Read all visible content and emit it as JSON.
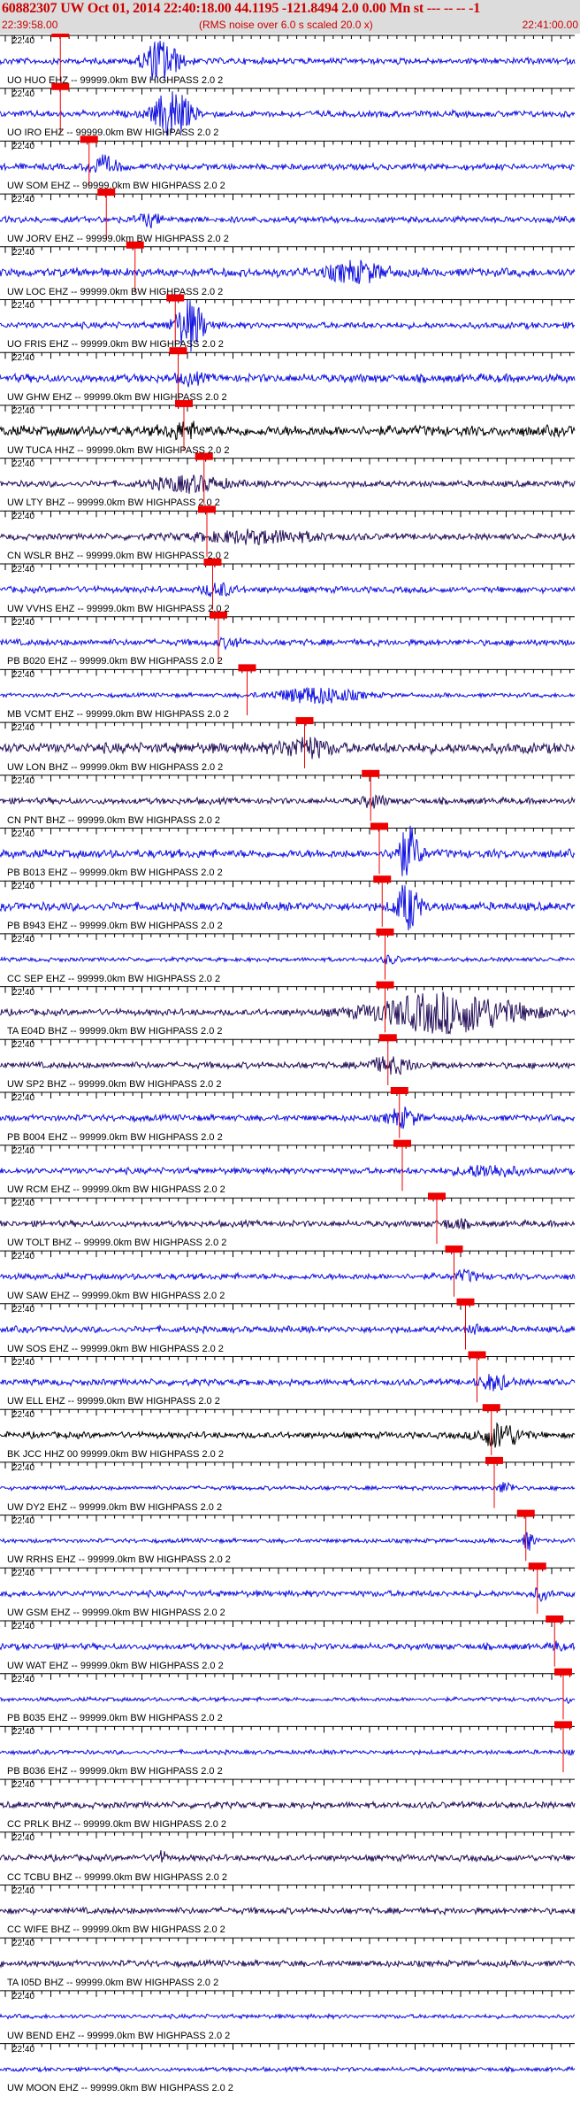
{
  "header": {
    "title": "60882307 UW Oct 01, 2014 22:40:18.00   44.1195 -121.8494  2.0 0.00 Mn st --- -- --  -1",
    "start_time": "22:39:58.00",
    "rms_note": "(RMS noise over 6.0 s scaled 20.0 x)",
    "end_time": "22:41:00.00"
  },
  "colors": {
    "header_text": "#cc0000",
    "header_bg": "#dcdcdc",
    "trace_blue": "#1010e0",
    "trace_dark": "#26105a",
    "trace_black": "#000000",
    "pick_box": "#ee0000",
    "grid": "#000000"
  },
  "time_tick_label": "22:40",
  "stations": [
    {
      "label": "UO HUO EHZ -- 99999.0km BW  HIGHPASS  2.0  2",
      "color": "blue",
      "amp": 3,
      "pick": 0.105,
      "burst": [
        0.28,
        0.06,
        24
      ]
    },
    {
      "label": "UO IRO EHZ -- 99999.0km BW  HIGHPASS  2.0  2",
      "color": "blue",
      "amp": 3,
      "pick": 0.105,
      "burst": [
        0.3,
        0.06,
        28
      ]
    },
    {
      "label": "UW SOM EHZ -- 99999.0km BW  HIGHPASS  2.0  2",
      "color": "blue",
      "amp": 3,
      "pick": 0.155,
      "burst": [
        0.18,
        0.05,
        10
      ]
    },
    {
      "label": "UW JORV EHZ -- 99999.0km BW  HIGHPASS  2.0  2",
      "color": "blue",
      "amp": 3,
      "pick": 0.185,
      "burst": [
        0.26,
        0.04,
        6
      ]
    },
    {
      "label": "UW LOC EHZ -- 99999.0km BW  HIGHPASS  2.0  2",
      "color": "blue",
      "amp": 4,
      "pick": 0.235,
      "burst": [
        0.62,
        0.1,
        10
      ]
    },
    {
      "label": "UO FRIS EHZ -- 99999.0km BW  HIGHPASS  2.0  2",
      "color": "blue",
      "amp": 3,
      "pick": 0.305,
      "burst": [
        0.33,
        0.05,
        28
      ]
    },
    {
      "label": "UW GHW EHZ -- 99999.0km BW  HIGHPASS  2.0  2",
      "color": "blue",
      "amp": 4,
      "pick": 0.31,
      "burst": [
        0.33,
        0.04,
        5
      ]
    },
    {
      "label": "UW TUCA HHZ -- 99999.0km BW  HIGHPASS  2.0  2",
      "color": "black",
      "amp": 5,
      "pick": 0.32,
      "burst": [
        0.32,
        0.06,
        7
      ]
    },
    {
      "label": "UW LTY BHZ -- 99999.0km BW  HIGHPASS  2.0  2",
      "color": "dark",
      "amp": 3,
      "pick": 0.355,
      "burst": [
        0.33,
        0.12,
        8
      ]
    },
    {
      "label": "CN WSLR BHZ -- 99999.0km BW  HIGHPASS  2.0  2",
      "color": "dark",
      "amp": 3,
      "pick": 0.36,
      "burst": [
        0.45,
        0.22,
        6
      ]
    },
    {
      "label": "UW VVHS EHZ -- 99999.0km BW  HIGHPASS  2.0  2",
      "color": "blue",
      "amp": 3,
      "pick": 0.37,
      "burst": [
        0.38,
        0.05,
        7
      ]
    },
    {
      "label": "PB B020 EHZ -- 99999.0km BW  HIGHPASS  2.0  2",
      "color": "blue",
      "amp": 3,
      "pick": 0.38,
      "burst": [
        0.4,
        0.04,
        4
      ]
    },
    {
      "label": "MB VCMT EHZ -- 99999.0km BW  HIGHPASS  2.0  2",
      "color": "blue",
      "amp": 2,
      "pick": 0.43,
      "burst": [
        0.55,
        0.14,
        9
      ]
    },
    {
      "label": "UW LON BHZ -- 99999.0km BW  HIGHPASS  2.0  2",
      "color": "dark",
      "amp": 5,
      "pick": 0.53,
      "burst": [
        0.53,
        0.08,
        10
      ]
    },
    {
      "label": "CN PNT BHZ -- 99999.0km BW  HIGHPASS  2.0  2",
      "color": "dark",
      "amp": 3,
      "pick": 0.645,
      "burst": [
        0.65,
        0.04,
        6
      ]
    },
    {
      "label": "PB B013 EHZ -- 99999.0km BW  HIGHPASS  2.0  2",
      "color": "blue",
      "amp": 4,
      "pick": 0.66,
      "burst": [
        0.71,
        0.04,
        28
      ]
    },
    {
      "label": "PB B943 EHZ -- 99999.0km BW  HIGHPASS  2.0  2",
      "color": "blue",
      "amp": 4,
      "pick": 0.665,
      "burst": [
        0.71,
        0.04,
        26
      ]
    },
    {
      "label": "CC SEP EHZ -- 99999.0km BW  HIGHPASS  2.0  2",
      "color": "blue",
      "amp": 2,
      "pick": 0.67,
      "burst": [
        0.68,
        0.03,
        4
      ]
    },
    {
      "label": "TA E04D BHZ -- 99999.0km BW  HIGHPASS  2.0  2",
      "color": "dark",
      "amp": 3,
      "pick": 0.67,
      "burst": [
        0.78,
        0.25,
        22
      ]
    },
    {
      "label": "UW SP2 BHZ -- 99999.0km BW  HIGHPASS  2.0  2",
      "color": "dark",
      "amp": 3,
      "pick": 0.675,
      "burst": [
        0.68,
        0.08,
        8
      ]
    },
    {
      "label": "PB B004 EHZ -- 99999.0km BW  HIGHPASS  2.0  2",
      "color": "blue",
      "amp": 3,
      "pick": 0.695,
      "burst": [
        0.7,
        0.05,
        10
      ]
    },
    {
      "label": "UW RCM EHZ -- 99999.0km BW  HIGHPASS  2.0  2",
      "color": "blue",
      "amp": 3,
      "pick": 0.7,
      "burst": [
        0.85,
        0.1,
        6
      ]
    },
    {
      "label": "UW TOLT BHZ -- 99999.0km BW  HIGHPASS  2.0  2",
      "color": "dark",
      "amp": 3,
      "pick": 0.76,
      "burst": [
        0.79,
        0.05,
        4
      ]
    },
    {
      "label": "UW SAW EHZ -- 99999.0km BW  HIGHPASS  2.0  2",
      "color": "blue",
      "amp": 3,
      "pick": 0.79,
      "burst": [
        0.81,
        0.04,
        5
      ]
    },
    {
      "label": "UW SOS EHZ -- 99999.0km BW  HIGHPASS  2.0  2",
      "color": "blue",
      "amp": 3,
      "pick": 0.81,
      "burst": [
        0.83,
        0.03,
        4
      ]
    },
    {
      "label": "UW ELL EHZ -- 99999.0km BW  HIGHPASS  2.0  2",
      "color": "blue",
      "amp": 3,
      "pick": 0.83,
      "burst": [
        0.86,
        0.05,
        8
      ]
    },
    {
      "label": "BK JCC HHZ 00 99999.0km BW  HIGHPASS  2.0  2",
      "color": "black",
      "amp": 3,
      "pick": 0.855,
      "burst": [
        0.87,
        0.07,
        14
      ]
    },
    {
      "label": "UW DY2 EHZ -- 99999.0km BW  HIGHPASS  2.0  2",
      "color": "blue",
      "amp": 2,
      "pick": 0.86,
      "burst": [
        0.88,
        0.03,
        6
      ]
    },
    {
      "label": "UW RRHS EHZ -- 99999.0km BW  HIGHPASS  2.0  2",
      "color": "blue",
      "amp": 2,
      "pick": 0.915,
      "burst": [
        0.92,
        0.02,
        10
      ]
    },
    {
      "label": "UW GSM EHZ -- 99999.0km BW  HIGHPASS  2.0  2",
      "color": "blue",
      "amp": 3,
      "pick": 0.935,
      "burst": [
        0.94,
        0.03,
        5
      ]
    },
    {
      "label": "UW WAT EHZ -- 99999.0km BW  HIGHPASS  2.0  2",
      "color": "blue",
      "amp": 3,
      "pick": 0.965,
      "burst": [
        0.97,
        0.02,
        4
      ]
    },
    {
      "label": "PB B035 EHZ -- 99999.0km BW  HIGHPASS  2.0  2",
      "color": "blue",
      "amp": 2,
      "pick": 0.98,
      "burst": [
        0.99,
        0.01,
        3
      ]
    },
    {
      "label": "PB B036 EHZ -- 99999.0km BW  HIGHPASS  2.0  2",
      "color": "blue",
      "amp": 2,
      "pick": 0.98,
      "burst": [
        0.99,
        0.01,
        2
      ]
    },
    {
      "label": "CC PRLK BHZ -- 99999.0km BW  HIGHPASS  2.0  2",
      "color": "dark",
      "amp": 3,
      "pick": null,
      "burst": [
        0.5,
        0.0,
        0
      ]
    },
    {
      "label": "CC TCBU BHZ -- 99999.0km BW  HIGHPASS  2.0  2",
      "color": "dark",
      "amp": 3,
      "pick": null,
      "burst": [
        0.28,
        0.02,
        6
      ]
    },
    {
      "label": "CC WIFE BHZ -- 99999.0km BW  HIGHPASS  2.0  2",
      "color": "dark",
      "amp": 3,
      "pick": null,
      "burst": [
        0.5,
        0.0,
        0
      ]
    },
    {
      "label": "TA I05D BHZ -- 99999.0km BW  HIGHPASS  2.0  2",
      "color": "dark",
      "amp": 3,
      "pick": null,
      "burst": [
        0.5,
        0.0,
        0
      ]
    },
    {
      "label": "UW BEND EHZ -- 99999.0km BW  HIGHPASS  2.0  2",
      "color": "blue",
      "amp": 2,
      "pick": null,
      "burst": [
        0.5,
        0.0,
        0
      ]
    },
    {
      "label": "UW MOON EHZ -- 99999.0km BW  HIGHPASS  2.0  2",
      "color": "blue",
      "amp": 2,
      "pick": null,
      "burst": [
        0.5,
        0.0,
        0
      ]
    }
  ]
}
